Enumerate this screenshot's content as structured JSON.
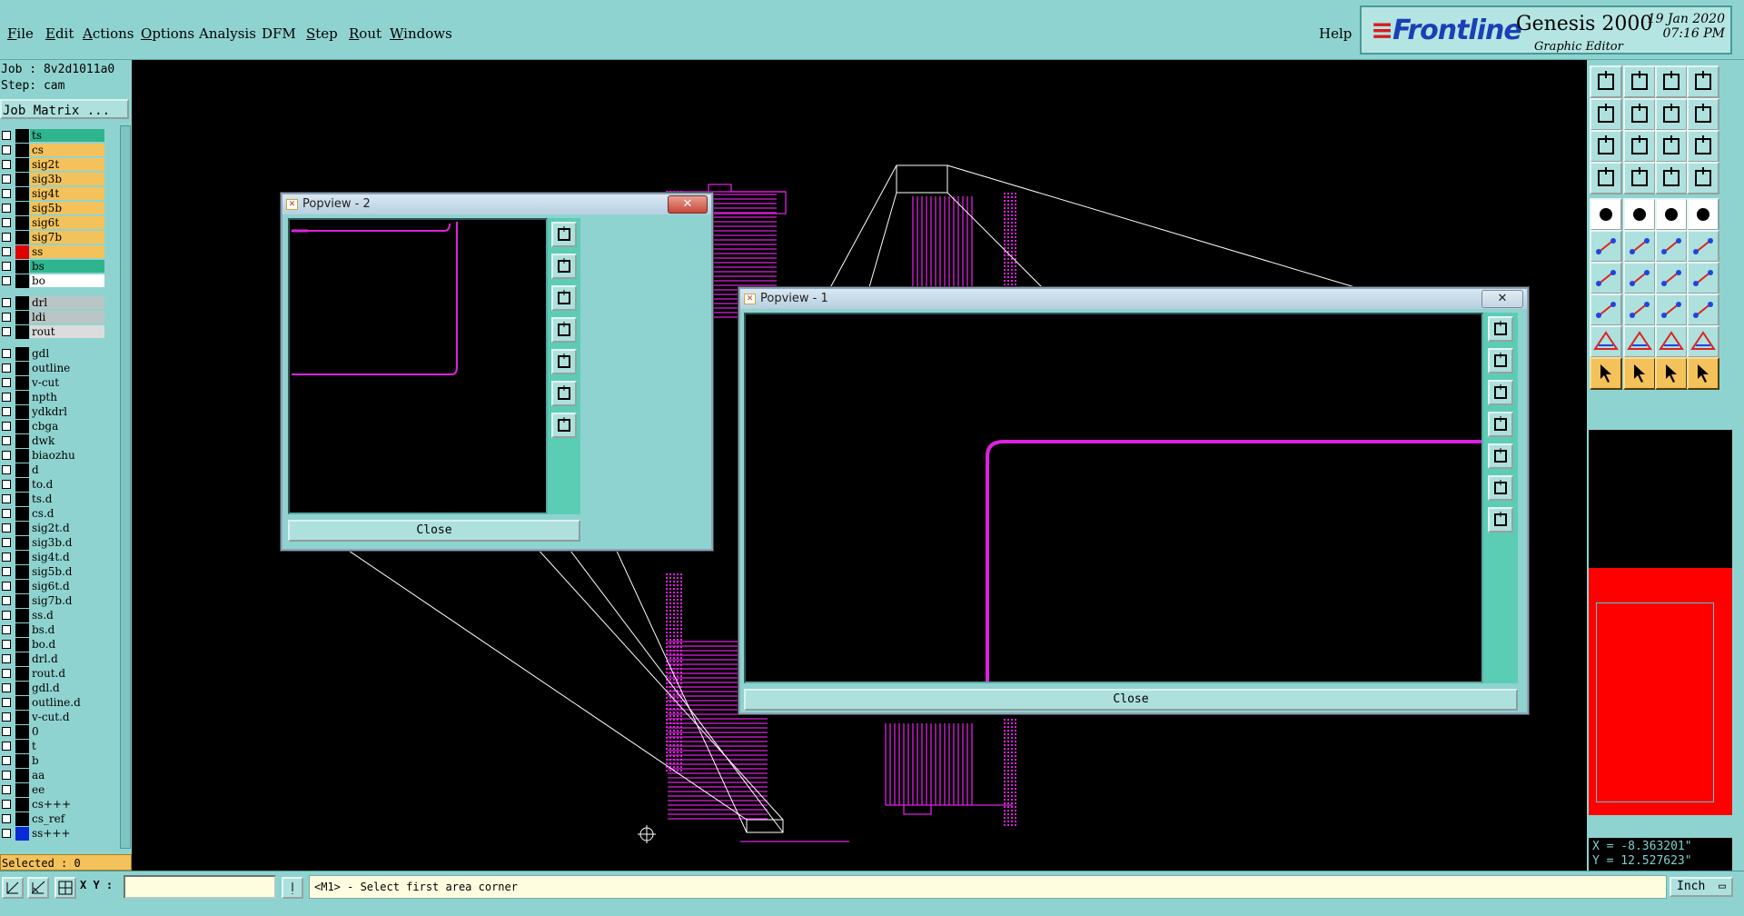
{
  "menu": {
    "items": [
      {
        "label": "File",
        "u": "F",
        "rest": "ile"
      },
      {
        "label": "Edit",
        "u": "E",
        "rest": "dit"
      },
      {
        "label": "Actions",
        "u": "A",
        "rest": "ctions"
      },
      {
        "label": "Options",
        "u": "O",
        "rest": "ptions"
      },
      {
        "label": "Analysis",
        "u": "",
        "rest": "Analysis"
      },
      {
        "label": "DFM",
        "u": "",
        "rest": "DFM"
      },
      {
        "label": "Step",
        "u": "S",
        "rest": "tep"
      },
      {
        "label": "Rout",
        "u": "R",
        "rest": "out"
      },
      {
        "label": "Windows",
        "u": "W",
        "rest": "indows"
      }
    ],
    "help": "Help"
  },
  "brand": {
    "logo": "Frontline",
    "product": "Genesis 2000",
    "subtitle": "Graphic Editor",
    "date": "19 Jan 2020",
    "time": "07:16 PM"
  },
  "job": {
    "job_line": "Job : 8v2d1011a0",
    "step_line": "Step: cam",
    "matrix_button": "Job Matrix ..."
  },
  "layers": [
    {
      "name": "ts",
      "color": "#2fb58e",
      "swatch": "#000"
    },
    {
      "name": "cs",
      "color": "#f4c25a",
      "swatch": "#000"
    },
    {
      "name": "sig2t",
      "color": "#f4c25a",
      "swatch": "#000"
    },
    {
      "name": "sig3b",
      "color": "#f4c25a",
      "swatch": "#000"
    },
    {
      "name": "sig4t",
      "color": "#f4c25a",
      "swatch": "#000"
    },
    {
      "name": "sig5b",
      "color": "#f4c25a",
      "swatch": "#000"
    },
    {
      "name": "sig6t",
      "color": "#f4c25a",
      "swatch": "#000"
    },
    {
      "name": "sig7b",
      "color": "#f4c25a",
      "swatch": "#000"
    },
    {
      "name": "ss",
      "color": "#f4c25a",
      "swatch": "#e00000"
    },
    {
      "name": "bs",
      "color": "#2fb58e",
      "swatch": "#000"
    },
    {
      "name": "bo",
      "color": "#ffffff",
      "swatch": "#000"
    },
    {
      "name": "drl",
      "color": "#b9c6c5",
      "swatch": "#000",
      "gap": true
    },
    {
      "name": "ldi",
      "color": "#b9c6c5",
      "swatch": "#000"
    },
    {
      "name": "rout",
      "color": "#dcdcdc",
      "swatch": "#000"
    },
    {
      "name": "gdl",
      "color": "#8fd3d0",
      "swatch": "#000",
      "gap": true
    },
    {
      "name": "outline",
      "color": "#8fd3d0",
      "swatch": "#000"
    },
    {
      "name": "v-cut",
      "color": "#8fd3d0",
      "swatch": "#000"
    },
    {
      "name": "npth",
      "color": "#8fd3d0",
      "swatch": "#000"
    },
    {
      "name": "ydkdrl",
      "color": "#8fd3d0",
      "swatch": "#000"
    },
    {
      "name": "cbga",
      "color": "#8fd3d0",
      "swatch": "#000"
    },
    {
      "name": "dwk",
      "color": "#8fd3d0",
      "swatch": "#000"
    },
    {
      "name": "biaozhu",
      "color": "#8fd3d0",
      "swatch": "#000"
    },
    {
      "name": "d",
      "color": "#8fd3d0",
      "swatch": "#000"
    },
    {
      "name": "to.d",
      "color": "#8fd3d0",
      "swatch": "#000"
    },
    {
      "name": "ts.d",
      "color": "#8fd3d0",
      "swatch": "#000"
    },
    {
      "name": "cs.d",
      "color": "#8fd3d0",
      "swatch": "#000"
    },
    {
      "name": "sig2t.d",
      "color": "#8fd3d0",
      "swatch": "#000"
    },
    {
      "name": "sig3b.d",
      "color": "#8fd3d0",
      "swatch": "#000"
    },
    {
      "name": "sig4t.d",
      "color": "#8fd3d0",
      "swatch": "#000"
    },
    {
      "name": "sig5b.d",
      "color": "#8fd3d0",
      "swatch": "#000"
    },
    {
      "name": "sig6t.d",
      "color": "#8fd3d0",
      "swatch": "#000"
    },
    {
      "name": "sig7b.d",
      "color": "#8fd3d0",
      "swatch": "#000"
    },
    {
      "name": "ss.d",
      "color": "#8fd3d0",
      "swatch": "#000"
    },
    {
      "name": "bs.d",
      "color": "#8fd3d0",
      "swatch": "#000"
    },
    {
      "name": "bo.d",
      "color": "#8fd3d0",
      "swatch": "#000"
    },
    {
      "name": "drl.d",
      "color": "#8fd3d0",
      "swatch": "#000"
    },
    {
      "name": "rout.d",
      "color": "#8fd3d0",
      "swatch": "#000"
    },
    {
      "name": "gdl.d",
      "color": "#8fd3d0",
      "swatch": "#000"
    },
    {
      "name": "outline.d",
      "color": "#8fd3d0",
      "swatch": "#000"
    },
    {
      "name": "v-cut.d",
      "color": "#8fd3d0",
      "swatch": "#000"
    },
    {
      "name": "0",
      "color": "#8fd3d0",
      "swatch": "#000"
    },
    {
      "name": "t",
      "color": "#8fd3d0",
      "swatch": "#000"
    },
    {
      "name": "b",
      "color": "#8fd3d0",
      "swatch": "#000"
    },
    {
      "name": "aa",
      "color": "#8fd3d0",
      "swatch": "#000"
    },
    {
      "name": "ee",
      "color": "#8fd3d0",
      "swatch": "#000"
    },
    {
      "name": "cs+++",
      "color": "#8fd3d0",
      "swatch": "#000"
    },
    {
      "name": "cs_ref",
      "color": "#8fd3d0",
      "swatch": "#000"
    },
    {
      "name": "ss+++",
      "color": "#8fd3d0",
      "swatch": "#0a2ad6"
    }
  ],
  "selected": "Selected : 0",
  "popups": {
    "p2": {
      "title": "Popview - 2",
      "close": "Close"
    },
    "p1": {
      "title": "Popview - 1",
      "close": "Close"
    }
  },
  "coords": {
    "x": "X = -8.363201\"",
    "y": "Y = 12.527623\""
  },
  "status": {
    "xy_label": "X Y :",
    "xy_value": "",
    "prompt": "<M1> - Select first area corner",
    "units": "Inch"
  },
  "colors": {
    "trace": "#e020e0",
    "panel": "#8fd3d0",
    "overview": "#ff0000"
  }
}
